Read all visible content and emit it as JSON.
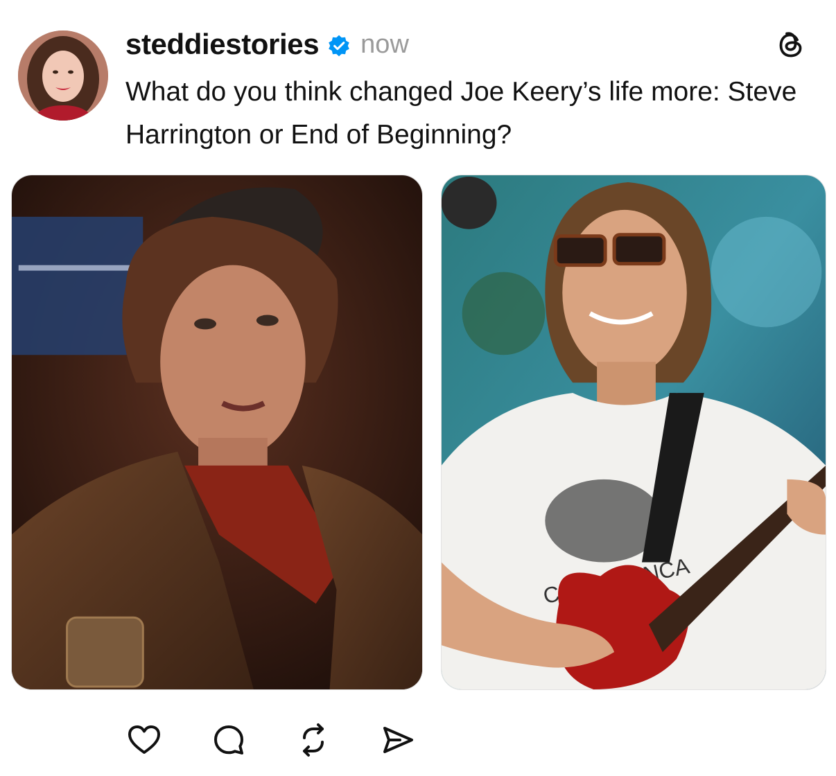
{
  "post": {
    "author": {
      "username": "steddiestories",
      "verified": true,
      "avatar_icon": "profile-photo-woman-smiling"
    },
    "timestamp": "now",
    "caption": "What do you think changed Joe Keery’s life more: Steve Harrington or End of Beginning?",
    "images": [
      {
        "icon": "photo-steve-harrington-leather-jacket"
      },
      {
        "icon": "photo-joe-keery-playing-red-guitar",
        "shirt_text": "CASABLANCA"
      }
    ],
    "actions": {
      "like_icon": "heart-icon",
      "reply_icon": "comment-icon",
      "repost_icon": "repost-icon",
      "share_icon": "send-icon"
    }
  },
  "app": {
    "logo_icon": "threads-logo-icon"
  },
  "colors": {
    "verified_blue": "#0095f6",
    "text_primary": "#111111",
    "text_secondary": "#9a9a9a"
  }
}
